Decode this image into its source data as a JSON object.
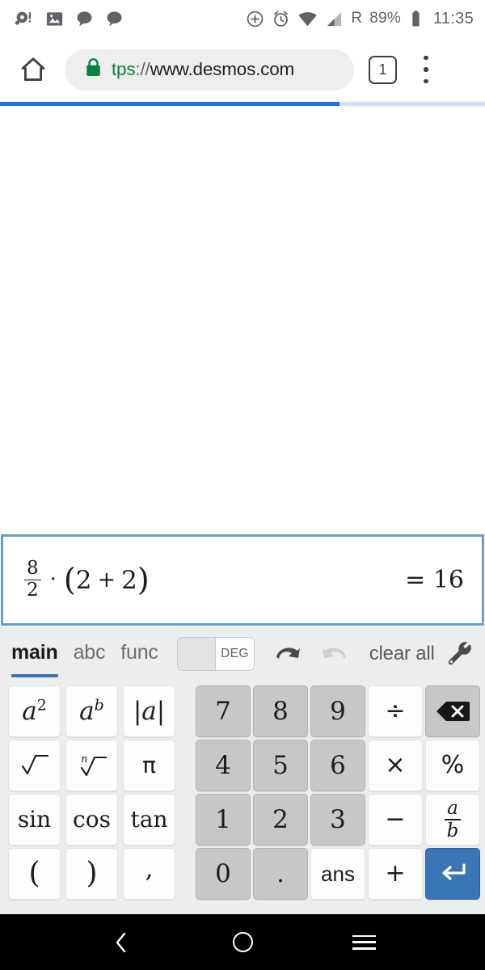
{
  "status_bar": {
    "left_icons": [
      "notification-alert-icon",
      "photo-icon",
      "message-bubble-icon",
      "message-bubble-icon"
    ],
    "right_icons": [
      "data-saver-icon",
      "alarm-icon",
      "wifi-icon",
      "cell-signal-icon"
    ],
    "roaming": "R",
    "battery_percent": "89%",
    "battery_icon": "battery-full-icon",
    "clock": "11:35"
  },
  "browser": {
    "home_icon": "home-icon",
    "lock_icon": "lock-icon",
    "url_scheme": "tps",
    "url_separator": "://",
    "url_host": "www.desmos.com",
    "url_full": "tps://www.desmos.com",
    "tab_count": "1",
    "menu_icon": "kebab-menu-icon",
    "progress_percent": 70,
    "progress_color": "#1a73e8"
  },
  "expression": {
    "numerator": "8",
    "denominator": "2",
    "multiply_symbol": "·",
    "open_paren": "(",
    "operand_a": "2",
    "plus": "+",
    "operand_b": "2",
    "close_paren": ")",
    "result": "= 16",
    "full_text": "8/2 · (2 + 2) = 16",
    "border_color": "#6a9bd1"
  },
  "keyboard": {
    "tabs": [
      {
        "label": "main",
        "active": true
      },
      {
        "label": "abc",
        "active": false
      },
      {
        "label": "func",
        "active": false
      }
    ],
    "angle_toggle": {
      "rad_label": "",
      "deg_label": "DEG",
      "selected": "DEG"
    },
    "undo_icon": "undo-arrow-icon",
    "redo_icon": "redo-arrow-icon",
    "clear_all_label": "clear all",
    "settings_icon": "wrench-icon",
    "accent_color": "#3a76b5",
    "left_keys": [
      {
        "name": "key-square",
        "label": "a2",
        "style": "white"
      },
      {
        "name": "key-power",
        "label": "ab",
        "style": "white"
      },
      {
        "name": "key-absolute",
        "label": "|a|",
        "style": "white"
      },
      {
        "name": "key-sqrt",
        "label": "√",
        "style": "white"
      },
      {
        "name": "key-nth-root",
        "label": "n√",
        "style": "white"
      },
      {
        "name": "key-pi",
        "label": "π",
        "style": "white"
      },
      {
        "name": "key-sin",
        "label": "sin",
        "style": "white"
      },
      {
        "name": "key-cos",
        "label": "cos",
        "style": "white"
      },
      {
        "name": "key-tan",
        "label": "tan",
        "style": "white"
      },
      {
        "name": "key-open-paren",
        "label": "(",
        "style": "white"
      },
      {
        "name": "key-close-paren",
        "label": ")",
        "style": "white"
      },
      {
        "name": "key-comma",
        "label": ",",
        "style": "white"
      }
    ],
    "right_keys": [
      {
        "name": "key-7",
        "label": "7",
        "style": "gray"
      },
      {
        "name": "key-8",
        "label": "8",
        "style": "gray"
      },
      {
        "name": "key-9",
        "label": "9",
        "style": "gray"
      },
      {
        "name": "key-divide",
        "label": "÷",
        "style": "white"
      },
      {
        "name": "key-backspace",
        "label": "⌫",
        "style": "gray"
      },
      {
        "name": "key-4",
        "label": "4",
        "style": "gray"
      },
      {
        "name": "key-5",
        "label": "5",
        "style": "gray"
      },
      {
        "name": "key-6",
        "label": "6",
        "style": "gray"
      },
      {
        "name": "key-multiply",
        "label": "×",
        "style": "white"
      },
      {
        "name": "key-percent",
        "label": "%",
        "style": "white"
      },
      {
        "name": "key-1",
        "label": "1",
        "style": "gray"
      },
      {
        "name": "key-2",
        "label": "2",
        "style": "gray"
      },
      {
        "name": "key-3",
        "label": "3",
        "style": "gray"
      },
      {
        "name": "key-minus",
        "label": "−",
        "style": "white"
      },
      {
        "name": "key-fraction",
        "label": "a/b",
        "style": "white"
      },
      {
        "name": "key-0",
        "label": "0",
        "style": "gray"
      },
      {
        "name": "key-decimal",
        "label": ".",
        "style": "gray"
      },
      {
        "name": "key-ans",
        "label": "ans",
        "style": "white"
      },
      {
        "name": "key-plus",
        "label": "+",
        "style": "white"
      },
      {
        "name": "key-enter",
        "label": "↵",
        "style": "blue"
      }
    ]
  },
  "nav_bar": {
    "back_icon": "back-chevron-icon",
    "home_icon": "home-circle-icon",
    "recents_icon": "recents-menu-icon"
  }
}
